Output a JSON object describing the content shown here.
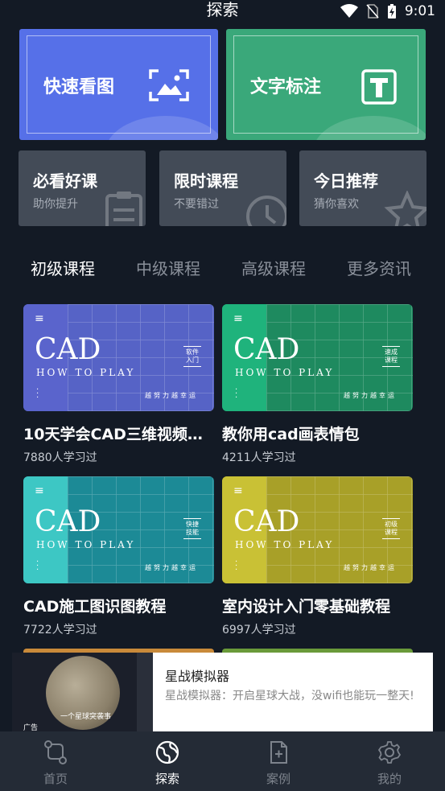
{
  "status_bar": {
    "title": "探索",
    "time": "9:01"
  },
  "quick_cards": [
    {
      "label": "快速看图",
      "icon": "image-view-icon",
      "color": "#5670e8"
    },
    {
      "label": "文字标注",
      "icon": "text-annotate-icon",
      "color": "#3aa87a"
    }
  ],
  "feature_cards": [
    {
      "title": "必看好课",
      "subtitle": "助你提升",
      "icon": "clipboard-icon"
    },
    {
      "title": "限时课程",
      "subtitle": "不要错过",
      "icon": "clock-icon"
    },
    {
      "title": "今日推荐",
      "subtitle": "猜你喜欢",
      "icon": "star-icon"
    }
  ],
  "tabs": [
    {
      "label": "初级课程",
      "active": true
    },
    {
      "label": "中级课程",
      "active": false
    },
    {
      "label": "高级课程",
      "active": false
    },
    {
      "label": "更多资讯",
      "active": false
    }
  ],
  "thumb_text": {
    "cad": "CAD",
    "howto": "HOW TO PLAY",
    "slogan": "越努力越幸运"
  },
  "courses": [
    {
      "title": "10天学会CAD三维视频…",
      "learners": "7880人学习过",
      "tag": "软件入门",
      "band": "#5a64cc",
      "bg": "#5663c6"
    },
    {
      "title": "教你用cad画表情包",
      "learners": "4211人学习过",
      "tag": "速成课程",
      "band": "#1fb37c",
      "bg": "#1e8a5f"
    },
    {
      "title": "CAD施工图识图教程",
      "learners": "7722人学习过",
      "tag": "快捷技能",
      "band": "#3dc7c4",
      "bg": "#1c8a96"
    },
    {
      "title": "室内设计入门零基础教程",
      "learners": "6997人学习过",
      "tag": "初级课程",
      "band": "#c9c135",
      "bg": "#a8a028"
    }
  ],
  "ad": {
    "title": "星战模拟器",
    "description": "星战模拟器：开启星球大战，没wifi也能玩一整天!",
    "image_caption": "一个星球突袭事",
    "tag": "广告"
  },
  "bottom_nav": [
    {
      "label": "首页",
      "icon": "home-path-icon",
      "active": false
    },
    {
      "label": "探索",
      "icon": "globe-icon",
      "active": true
    },
    {
      "label": "案例",
      "icon": "document-icon",
      "active": false
    },
    {
      "label": "我的",
      "icon": "gear-icon",
      "active": false
    }
  ]
}
